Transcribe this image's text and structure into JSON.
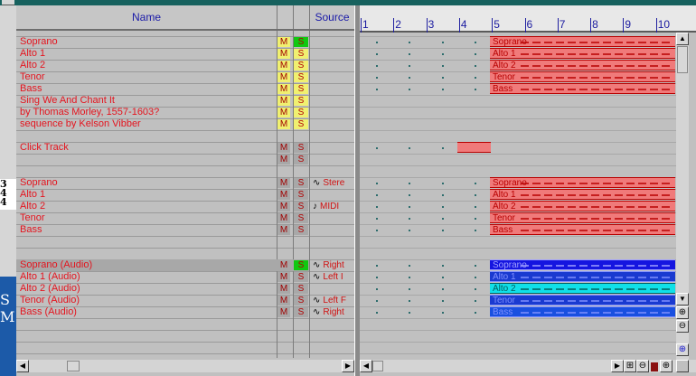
{
  "header": {
    "name_label": "Name",
    "source_label": "Source"
  },
  "tracks": [
    {
      "name": "Soprano",
      "row": 0,
      "m": "M",
      "s": "S",
      "src": "",
      "ms": "yellow",
      "ss": "green"
    },
    {
      "name": "Alto 1",
      "row": 1,
      "m": "M",
      "s": "S",
      "src": "",
      "ms": "yellow",
      "ss": "yellow"
    },
    {
      "name": "Alto 2",
      "row": 2,
      "m": "M",
      "s": "S",
      "src": "",
      "ms": "yellow",
      "ss": "yellow"
    },
    {
      "name": "Tenor",
      "row": 3,
      "m": "M",
      "s": "S",
      "src": "",
      "ms": "yellow",
      "ss": "yellow"
    },
    {
      "name": "Bass",
      "row": 4,
      "m": "M",
      "s": "S",
      "src": "",
      "ms": "yellow",
      "ss": "yellow"
    },
    {
      "name": "Sing We And Chant It",
      "row": 5,
      "m": "M",
      "s": "S",
      "src": "",
      "ms": "yellow",
      "ss": "yellow"
    },
    {
      "name": "by Thomas Morley, 1557-1603?",
      "row": 6,
      "m": "M",
      "s": "S",
      "src": "",
      "ms": "yellow",
      "ss": "yellow"
    },
    {
      "name": "sequence by Kelson Vibber",
      "row": 7,
      "m": "M",
      "s": "S",
      "src": "",
      "ms": "yellow",
      "ss": "yellow"
    },
    {
      "name": "Click Track",
      "row": 9,
      "m": "M",
      "s": "S",
      "src": "",
      "ms": "gray",
      "ss": "gray"
    },
    {
      "name": "",
      "row": 10,
      "m": "M",
      "s": "S",
      "src": "",
      "ms": "gray",
      "ss": "gray"
    },
    {
      "name": "Soprano",
      "row": 12,
      "m": "M",
      "s": "S",
      "src": "Stere",
      "icon": "wave",
      "ms": "gray",
      "ss": "gray"
    },
    {
      "name": "Alto 1",
      "row": 13,
      "m": "M",
      "s": "S",
      "src": "",
      "ms": "gray",
      "ss": "gray"
    },
    {
      "name": "Alto 2",
      "row": 14,
      "m": "M",
      "s": "S",
      "src": "MIDI",
      "icon": "note",
      "ms": "gray",
      "ss": "gray"
    },
    {
      "name": "Tenor",
      "row": 15,
      "m": "M",
      "s": "S",
      "src": "",
      "ms": "gray",
      "ss": "gray"
    },
    {
      "name": "Bass",
      "row": 16,
      "m": "M",
      "s": "S",
      "src": "",
      "ms": "gray",
      "ss": "gray"
    },
    {
      "name": "Soprano (Audio)",
      "row": 19,
      "m": "M",
      "s": "S",
      "src": "Right",
      "icon": "wave",
      "ms": "gray",
      "ss": "green",
      "selected": true
    },
    {
      "name": "Alto 1      (Audio)",
      "row": 20,
      "m": "M",
      "s": "S",
      "src": "Left I",
      "icon": "wave",
      "ms": "gray",
      "ss": "gray"
    },
    {
      "name": "Alto 2    (Audio)",
      "row": 21,
      "m": "M",
      "s": "S",
      "src": "",
      "ms": "gray",
      "ss": "gray"
    },
    {
      "name": "Tenor     (Audio)",
      "row": 22,
      "m": "M",
      "s": "S",
      "src": "Left F",
      "icon": "wave",
      "ms": "gray",
      "ss": "gray"
    },
    {
      "name": "Bass      (Audio)",
      "row": 23,
      "m": "M",
      "s": "S",
      "src": "Right",
      "icon": "wave",
      "ms": "gray",
      "ss": "gray"
    }
  ],
  "ruler": {
    "bars": [
      "1",
      "2",
      "3",
      "4",
      "5",
      "6",
      "7",
      "8",
      "9",
      "10"
    ]
  },
  "parts": [
    {
      "label": "Soprano",
      "row": 0,
      "color": "#f07a7a",
      "text": "#b80000"
    },
    {
      "label": "Alto 1",
      "row": 1,
      "color": "#f07a7a",
      "text": "#b80000"
    },
    {
      "label": "Alto 2",
      "row": 2,
      "color": "#f07a7a",
      "text": "#b80000"
    },
    {
      "label": "Tenor",
      "row": 3,
      "color": "#f07a7a",
      "text": "#b80000"
    },
    {
      "label": "Bass",
      "row": 4,
      "color": "#f07a7a",
      "text": "#b80000"
    },
    {
      "label": "",
      "row": 9,
      "color": "#f07a7a",
      "text": "#b80000",
      "short": true
    },
    {
      "label": "Soprano",
      "row": 12,
      "color": "#f07a7a",
      "text": "#b80000"
    },
    {
      "label": "Alto 1",
      "row": 13,
      "color": "#f07a7a",
      "text": "#b80000"
    },
    {
      "label": "Alto 2",
      "row": 14,
      "color": "#f07a7a",
      "text": "#b80000"
    },
    {
      "label": "Tenor",
      "row": 15,
      "color": "#f07a7a",
      "text": "#b80000"
    },
    {
      "label": "Bass",
      "row": 16,
      "color": "#f07a7a",
      "text": "#b80000"
    },
    {
      "label": "Soprano",
      "row": 19,
      "color": "#1515e0",
      "text": "#a0a0ff"
    },
    {
      "label": "Alto 1",
      "row": 20,
      "color": "#1a3ad0",
      "text": "#8090ff"
    },
    {
      "label": "Alto 2",
      "row": 21,
      "color": "#10e0e8",
      "text": "#006060"
    },
    {
      "label": "Tenor",
      "row": 22,
      "color": "#1a3ad0",
      "text": "#8090ff"
    },
    {
      "label": "Bass",
      "row": 23,
      "color": "#1a50e0",
      "text": "#8090ff"
    }
  ],
  "left_fragment": {
    "chars": "3\n4\n4"
  },
  "colors": {
    "yellow": "#f0f070",
    "green": "#10c810",
    "gray": "#a8a8a8",
    "track_text": "#e4141e"
  }
}
